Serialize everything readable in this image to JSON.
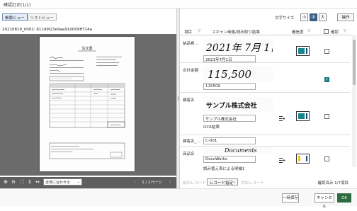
{
  "window": {
    "title": "確認訂正(1/1)"
  },
  "left": {
    "tabs": [
      {
        "label": "帳票ビュー",
        "active": true
      },
      {
        "label": "リストビュー",
        "active": false
      }
    ],
    "doc_id": "20210819_0002: 611d9f23e9ae910009ff714a",
    "preview_title": "注文書",
    "fit_select": "全体に合わせる",
    "pager": "1 / 1ページ"
  },
  "right": {
    "font_size_label": "文字サイズ",
    "font_sizes": [
      {
        "label": "小",
        "active": false
      },
      {
        "label": "中",
        "active": true
      },
      {
        "label": "大",
        "active": false
      }
    ],
    "operation_button": "操作",
    "headers": {
      "item": "項目",
      "scan": "スキャン画像/読み取り結果",
      "confidence": "確信度",
      "check": "確認"
    },
    "rows": [
      {
        "name": "納品希...",
        "handwriting": "2021年 7月 1日",
        "ocr": "2021年7月1日",
        "note": "",
        "has_menu": false,
        "confidence": 0.55,
        "checked": false
      },
      {
        "name": "合計金額",
        "handwriting": "115,500",
        "ocr": "115500",
        "note": "",
        "has_menu": false,
        "confidence": 0.0,
        "checked": true
      },
      {
        "name": "顧客名",
        "handwriting": "サンプル株式会社",
        "ocr": "サンプル株式会社",
        "note": "OCR結果",
        "has_menu": true,
        "confidence": 0.55,
        "checked": false
      },
      {
        "name": "顧客名_...",
        "handwriting": "",
        "ocr": "C-001",
        "note": "",
        "has_menu": false,
        "confidence": null,
        "checked": false
      },
      {
        "name": "商品名",
        "handwriting": "Documents",
        "ocr": "DocuWorks",
        "note": "読み替え表による候補1",
        "has_menu": true,
        "confidence": 0.2,
        "checked": false
      }
    ],
    "nav": {
      "prev": "前のレコード",
      "record_select": "レコード指定",
      "next": "次のレコード"
    },
    "progress": "確認済み 1/7項目"
  },
  "footer": {
    "save_temp": "一時保存",
    "cancel": "キャンセル",
    "ok": "OK"
  },
  "colors": {
    "accent": "#3b5e86",
    "confidence_fill": "#17868c",
    "ok": "#2d6a3e",
    "highlight": "#f0c020"
  }
}
